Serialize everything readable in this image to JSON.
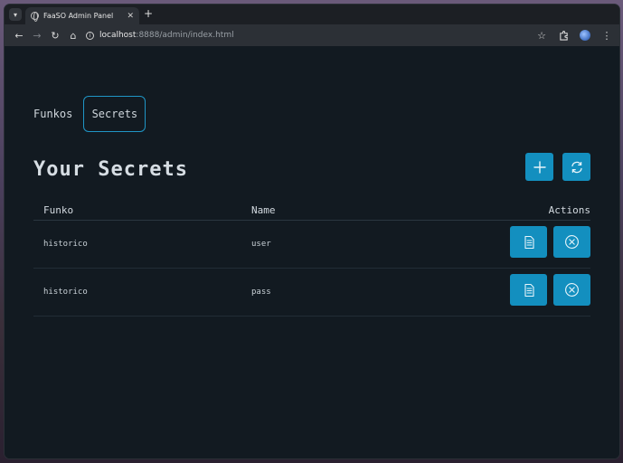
{
  "browser": {
    "tab_title": "FaaSO Admin Panel",
    "url_host": "localhost",
    "url_rest": ":8888/admin/index.html"
  },
  "nav": {
    "items": [
      {
        "label": "Funkos",
        "active": false
      },
      {
        "label": "Secrets",
        "active": true
      }
    ]
  },
  "page": {
    "title": "Your Secrets"
  },
  "table": {
    "columns": {
      "funko": "Funko",
      "name": "Name",
      "actions": "Actions"
    },
    "rows": [
      {
        "funko": "historico",
        "name": "user"
      },
      {
        "funko": "historico",
        "name": "pass"
      }
    ]
  },
  "colors": {
    "accent": "#138fbf",
    "background": "#121a21"
  }
}
